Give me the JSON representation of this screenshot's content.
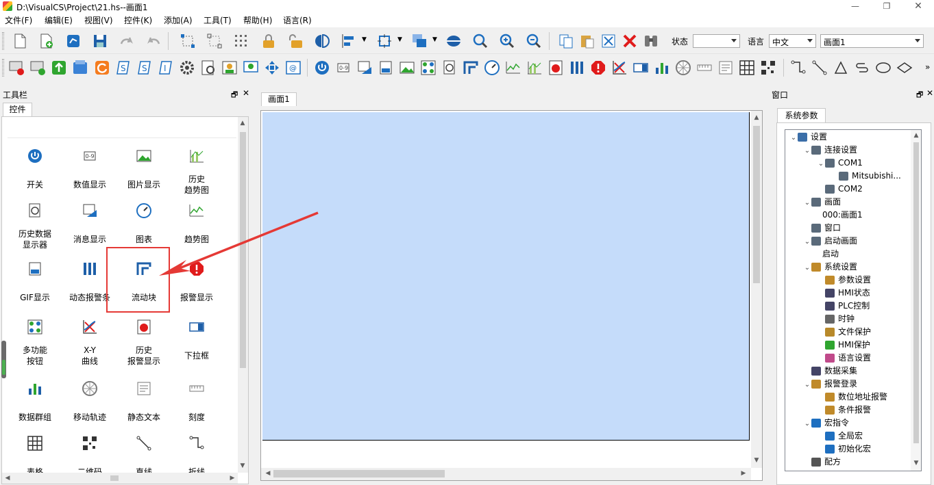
{
  "window": {
    "title": "D:\\VisualCS\\Project\\21.hs--画面1"
  },
  "menu": [
    "文件(F)",
    "编辑(E)",
    "视图(V)",
    "控件(K)",
    "添加(A)",
    "工具(T)",
    "帮助(H)",
    "语言(R)"
  ],
  "toolbar": {
    "status_label": "状态",
    "status_value": "",
    "lang_label": "语言",
    "lang_value": "中文",
    "screen_value": "画面1"
  },
  "toolbox": {
    "title": "工具栏",
    "tab": "控件",
    "items": [
      [
        "开关",
        "power-icon"
      ],
      [
        "数值显示",
        "numeric-display-icon"
      ],
      [
        "图片显示",
        "picture-icon"
      ],
      [
        "历史\n趋势图",
        "history-trend-icon"
      ],
      [
        "历史数据\n显示器",
        "history-data-icon"
      ],
      [
        "消息显示",
        "message-icon"
      ],
      [
        "图表",
        "gauge-icon"
      ],
      [
        "趋势图",
        "trend-icon"
      ],
      [
        "GIF显示",
        "gif-icon"
      ],
      [
        "动态报警条",
        "alarm-bar-icon"
      ],
      [
        "流动块",
        "flow-block-icon"
      ],
      [
        "报警显示",
        "alarm-icon"
      ],
      [
        "多功能\n按钮",
        "multi-button-icon"
      ],
      [
        "X-Y\n曲线",
        "xy-curve-icon"
      ],
      [
        "历史\n报警显示",
        "history-alarm-icon"
      ],
      [
        "下拉框",
        "dropdown-icon"
      ],
      [
        "数据群组",
        "bar-group-icon"
      ],
      [
        "移动轨迹",
        "track-icon"
      ],
      [
        "静态文本",
        "static-text-icon"
      ],
      [
        "刻度",
        "scale-icon"
      ],
      [
        "表格",
        "table-icon"
      ],
      [
        "二维码",
        "qrcode-icon"
      ],
      [
        "直线",
        "line-icon"
      ],
      [
        "折线",
        "polyline-icon"
      ]
    ]
  },
  "document": {
    "tab": "画面1"
  },
  "window_panel": {
    "title": "窗口",
    "tab": "系统参数",
    "tree": [
      {
        "label": "设置",
        "level": 0,
        "exp": "v"
      },
      {
        "label": "连接设置",
        "level": 1,
        "exp": "v"
      },
      {
        "label": "COM1",
        "level": 2,
        "exp": "v"
      },
      {
        "label": "Mitsubishi...",
        "level": 3,
        "exp": ""
      },
      {
        "label": "COM2",
        "level": 2,
        "exp": ""
      },
      {
        "label": "画面",
        "level": 1,
        "exp": "v"
      },
      {
        "label": "000:画面1",
        "level": 2,
        "exp": "",
        "noicon": true
      },
      {
        "label": "窗口",
        "level": 1,
        "exp": ""
      },
      {
        "label": "启动画面",
        "level": 1,
        "exp": "v"
      },
      {
        "label": "启动",
        "level": 2,
        "exp": "",
        "noicon": true
      },
      {
        "label": "系统设置",
        "level": 1,
        "exp": "v"
      },
      {
        "label": "参数设置",
        "level": 2,
        "exp": ""
      },
      {
        "label": "HMI状态",
        "level": 2,
        "exp": ""
      },
      {
        "label": "PLC控制",
        "level": 2,
        "exp": ""
      },
      {
        "label": "时钟",
        "level": 2,
        "exp": ""
      },
      {
        "label": "文件保护",
        "level": 2,
        "exp": ""
      },
      {
        "label": "HMI保护",
        "level": 2,
        "exp": ""
      },
      {
        "label": "语言设置",
        "level": 2,
        "exp": ""
      },
      {
        "label": "数据采集",
        "level": 1,
        "exp": ""
      },
      {
        "label": "报警登录",
        "level": 1,
        "exp": "v"
      },
      {
        "label": "数位地址报警",
        "level": 2,
        "exp": ""
      },
      {
        "label": "条件报警",
        "level": 2,
        "exp": ""
      },
      {
        "label": "宏指令",
        "level": 1,
        "exp": "v"
      },
      {
        "label": "全局宏",
        "level": 2,
        "exp": ""
      },
      {
        "label": "初始化宏",
        "level": 2,
        "exp": ""
      },
      {
        "label": "配方",
        "level": 1,
        "exp": ""
      }
    ]
  },
  "colors": {
    "canvas": "#c5dcfa",
    "highlight": "#e53935"
  }
}
